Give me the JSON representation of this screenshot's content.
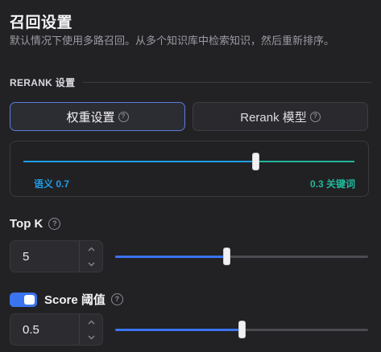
{
  "header": {
    "title": "召回设置",
    "description": "默认情况下使用多路召回。从多个知识库中检索知识，然后重新排序。"
  },
  "section": {
    "label": "RERANK 设置"
  },
  "tabs": {
    "weight_label": "权重设置",
    "rerank_label": "Rerank 模型",
    "active": "权重设置"
  },
  "weights": {
    "semantic_label": "语义 0.7",
    "keyword_label": "0.3 关键词",
    "semantic_value": 0.7,
    "keyword_value": 0.3,
    "semantic_color": "#1d9ee8",
    "keyword_color": "#21b79b"
  },
  "top_k": {
    "label": "Top K",
    "value": "5",
    "slider_fraction": 0.44
  },
  "score": {
    "label": "Score 阈值",
    "enabled": true,
    "value": "0.5",
    "slider_fraction": 0.5
  },
  "colors": {
    "accent": "#3b74f0",
    "background": "#222225"
  },
  "icons": {
    "help": "help-circle-icon",
    "increment": "chevron-up-icon",
    "decrement": "chevron-down-icon"
  }
}
